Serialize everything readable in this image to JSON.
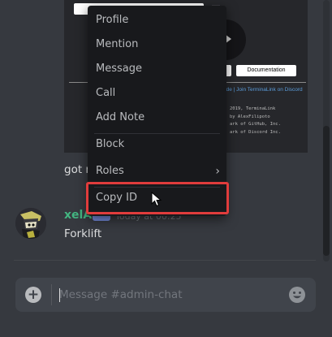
{
  "embed": {
    "button_documentation": "Documentation",
    "links": "ode | Join TerminaLink on Discord",
    "legal_lines": [
      "2019, TerminaLink",
      " by AlexFilipoto",
      "ark of GitHub, Inc.",
      "ark of Discord Inc."
    ]
  },
  "messages": [
    {
      "text": "got n"
    },
    {
      "author": "xelA",
      "timestamp": "Today at 00:25",
      "text": "Forklift",
      "author_color": "#43b581"
    }
  ],
  "composer": {
    "placeholder": "Message #admin-chat"
  },
  "context_menu": {
    "items": [
      {
        "label": "Profile"
      },
      {
        "label": "Mention"
      },
      {
        "label": "Message"
      },
      {
        "label": "Call"
      },
      {
        "label": "Add Note"
      },
      {
        "label": "Block"
      },
      {
        "label": "Roles",
        "has_submenu": true
      },
      {
        "label": "Copy ID",
        "highlighted": true
      }
    ]
  },
  "colors": {
    "background": "#36393f",
    "menu": "#18191c",
    "highlight_border": "#e03c3c",
    "accent": "#7289da"
  }
}
